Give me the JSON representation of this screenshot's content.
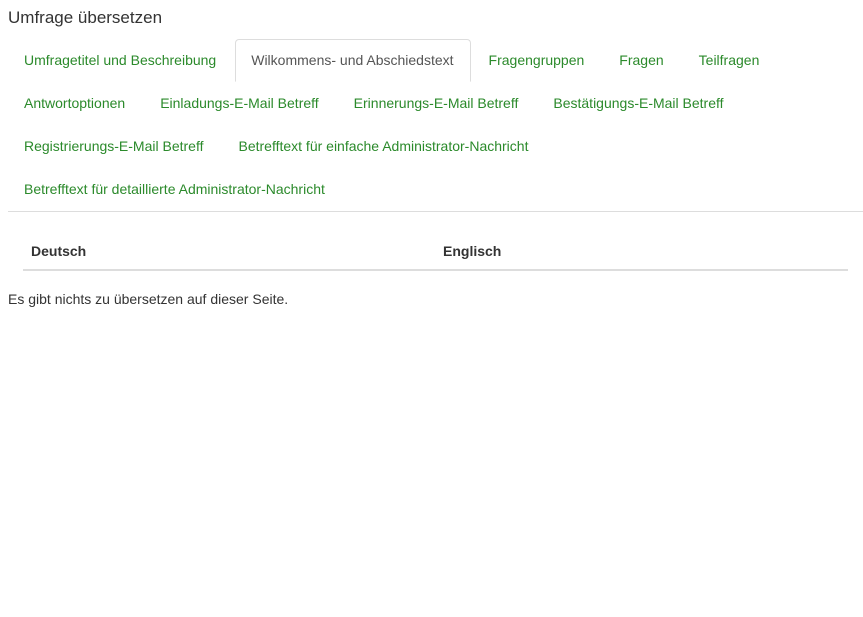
{
  "page_title": "Umfrage übersetzen",
  "tabs": [
    {
      "label": "Umfragetitel und Beschreibung",
      "active": false
    },
    {
      "label": "Wilkommens- und Abschiedstext",
      "active": true
    },
    {
      "label": "Fragengruppen",
      "active": false
    },
    {
      "label": "Fragen",
      "active": false
    },
    {
      "label": "Teilfragen",
      "active": false
    },
    {
      "label": "Antwortoptionen",
      "active": false
    },
    {
      "label": "Einladungs-E-Mail Betreff",
      "active": false
    },
    {
      "label": "Erinnerungs-E-Mail Betreff",
      "active": false
    },
    {
      "label": "Bestätigungs-E-Mail Betreff",
      "active": false
    },
    {
      "label": "Registrierungs-E-Mail Betreff",
      "active": false
    },
    {
      "label": "Betrefftext für einfache Administrator-Nachricht",
      "active": false
    },
    {
      "label": "Betrefftext für detaillierte Administrator-Nachricht",
      "active": false
    }
  ],
  "table": {
    "columns": [
      "Deutsch",
      "Englisch"
    ]
  },
  "message": "Es gibt nichts zu übersetzen auf dieser Seite.",
  "colors": {
    "link": "#2b8a2b",
    "border": "#dddddd"
  }
}
